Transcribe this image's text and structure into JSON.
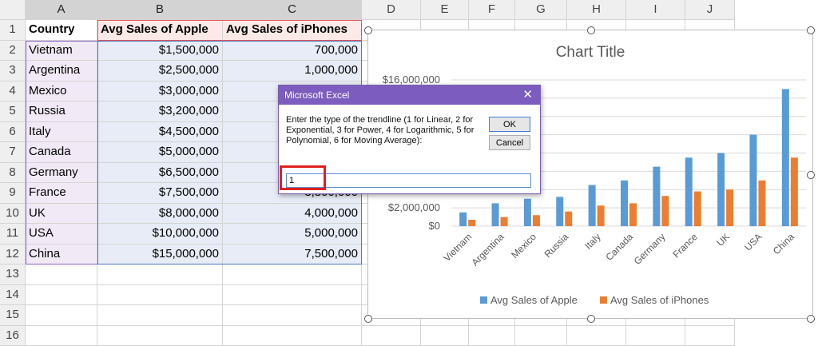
{
  "columns": [
    "A",
    "B",
    "C",
    "D",
    "E",
    "F",
    "G",
    "H",
    "I",
    "J"
  ],
  "rows": [
    "1",
    "2",
    "3",
    "4",
    "5",
    "6",
    "7",
    "8",
    "9",
    "10",
    "11",
    "12",
    "13",
    "14",
    "15",
    "16"
  ],
  "table": {
    "headers": [
      "Country",
      "Avg Sales of Apple",
      "Avg Sales of iPhones"
    ],
    "data": [
      [
        "Vietnam",
        "$1,500,000",
        "700,000"
      ],
      [
        "Argentina",
        "$2,500,000",
        "1,000,000"
      ],
      [
        "Mexico",
        "$3,000,000",
        ""
      ],
      [
        "Russia",
        "$3,200,000",
        ""
      ],
      [
        "Italy",
        "$4,500,000",
        ""
      ],
      [
        "Canada",
        "$5,000,000",
        ""
      ],
      [
        "Germany",
        "$6,500,000",
        ""
      ],
      [
        "France",
        "$7,500,000",
        "3,800,000"
      ],
      [
        "UK",
        "$8,000,000",
        "4,000,000"
      ],
      [
        "USA",
        "$10,000,000",
        "5,000,000"
      ],
      [
        "China",
        "$15,000,000",
        "7,500,000"
      ]
    ]
  },
  "chart_data": {
    "type": "bar",
    "title": "Chart Title",
    "categories": [
      "Vietnam",
      "Argentina",
      "Mexico",
      "Russia",
      "Italy",
      "Canada",
      "Germany",
      "France",
      "UK",
      "USA",
      "China"
    ],
    "series": [
      {
        "name": "Avg Sales of Apple",
        "values": [
          1500000,
          2500000,
          3000000,
          3200000,
          4500000,
          5000000,
          6500000,
          7500000,
          8000000,
          10000000,
          15000000
        ],
        "color": "#5b9bd5"
      },
      {
        "name": "Avg Sales of iPhones",
        "values": [
          700000,
          1000000,
          1200000,
          1600000,
          2250000,
          2500000,
          3300000,
          3800000,
          4000000,
          5000000,
          7500000
        ],
        "color": "#ed7d31"
      }
    ],
    "ylim": [
      0,
      16000000
    ],
    "ytick_labels_visible": [
      "$16,000,000",
      "$2,000,000",
      "$0"
    ],
    "grid": true,
    "legend": "bottom"
  },
  "dialog": {
    "title": "Microsoft Excel",
    "close_glyph": "✕",
    "prompt": "Enter the type of the trendline (1 for Linear, 2 for Exponential, 3 for Power, 4 for Logarithmic, 5 for Polynomial, 6 for Moving Average):",
    "ok_label": "OK",
    "cancel_label": "Cancel",
    "input_value": "1"
  },
  "colors": {
    "accent": "#7c5cbf",
    "apple_series": "#5b9bd5",
    "iphone_series": "#ed7d31",
    "highlight": "#e02020"
  }
}
